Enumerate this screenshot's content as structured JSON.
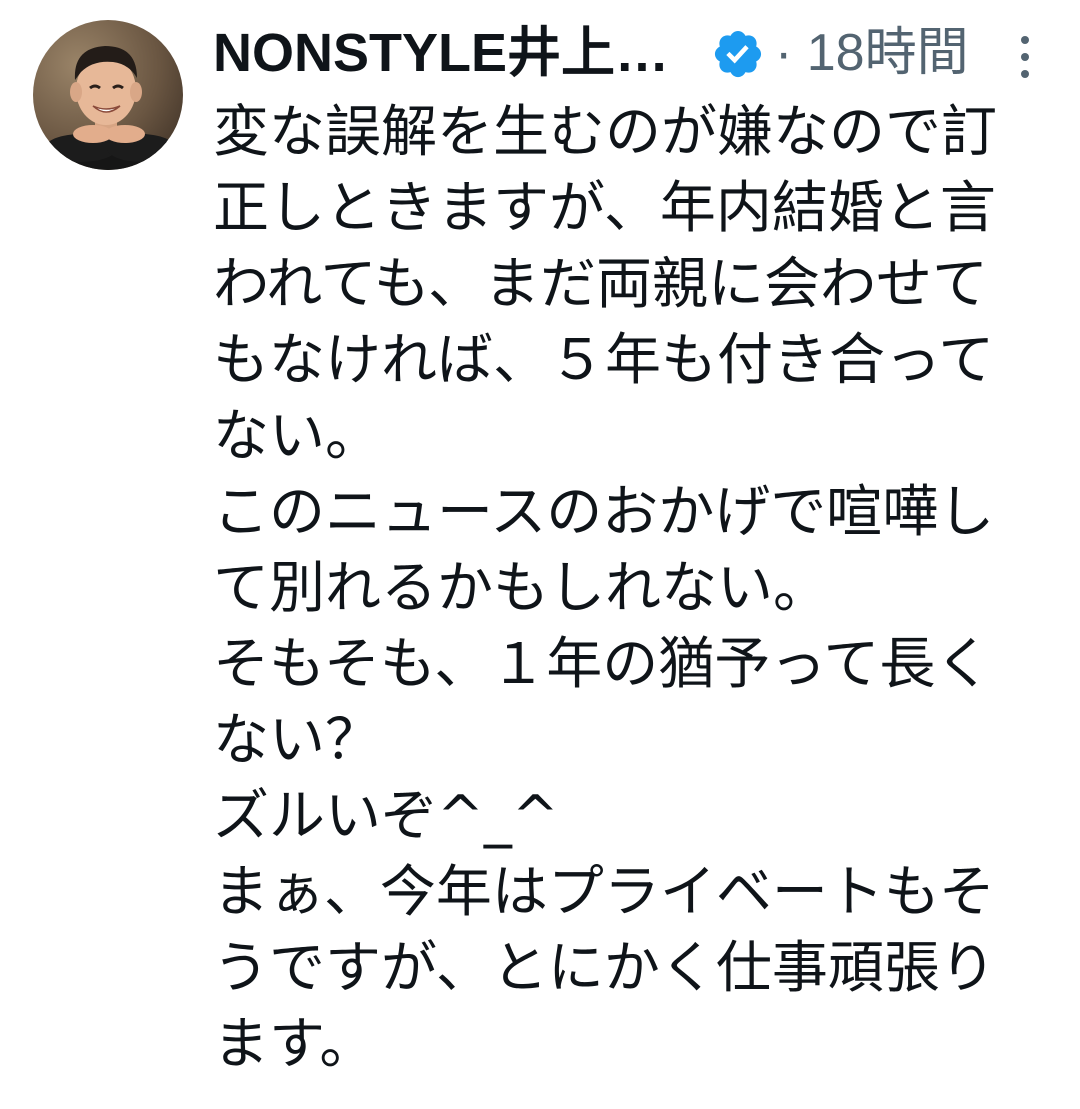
{
  "colors": {
    "text": "#0f1419",
    "muted": "#536471",
    "accent": "#1d9bf0",
    "background": "#ffffff"
  },
  "icons": {
    "avatar": "profile-photo",
    "verified": "verified-badge-icon",
    "more": "more-options-icon"
  },
  "tweet": {
    "author": {
      "name": "NONSTYLE井上…",
      "verified": true
    },
    "time": "· 18時間",
    "lines": [
      "変な誤解を生むのが嫌なので訂",
      "正しときますが、年内結婚と言",
      "われても、まだ両親に会わせて",
      "もなければ、５年も付き合って",
      "ない。",
      "このニュースのおかげで喧嘩し",
      "て別れるかもしれない。",
      "そもそも、１年の猶予って長く",
      "ない？",
      "ズルいぞ^_^",
      "まぁ、今年はプライベートもそ",
      "うですが、とにかく仕事頑張り",
      "ます。"
    ]
  }
}
